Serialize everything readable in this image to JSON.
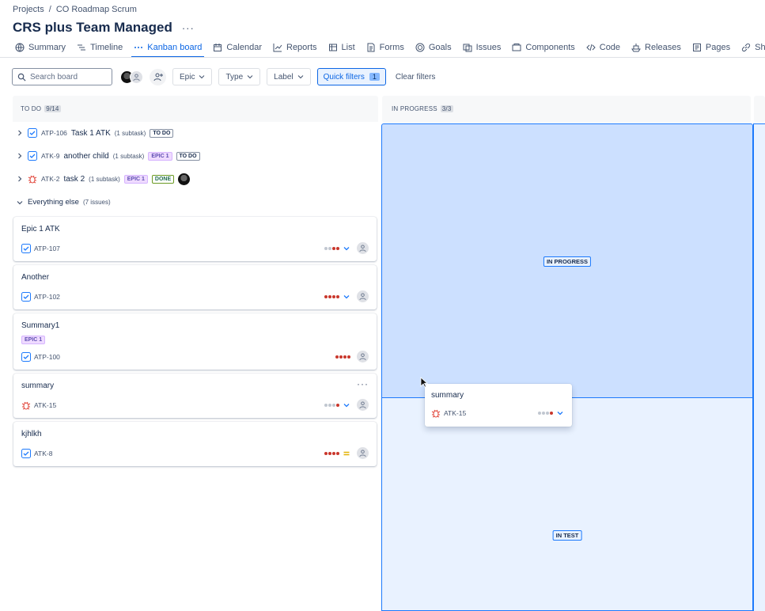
{
  "breadcrumb": {
    "root": "Projects",
    "sep": "/",
    "project": "CO Roadmap Scrum"
  },
  "page": {
    "title": "CRS plus Team Managed",
    "more": "···"
  },
  "tabs": [
    "Summary",
    "Timeline",
    "Kanban board",
    "Calendar",
    "Reports",
    "List",
    "Forms",
    "Goals",
    "Issues",
    "Components",
    "Code",
    "Releases",
    "Pages",
    "Shortcuts"
  ],
  "active_tab": "Kanban board",
  "toolbar": {
    "search_placeholder": "Search board",
    "epic": "Epic",
    "type": "Type",
    "label": "Label",
    "quick_filters": "Quick filters",
    "quick_filters_count": "1",
    "clear": "Clear filters"
  },
  "columns": {
    "todo": {
      "name": "TO DO",
      "count": "9/14"
    },
    "in_progress": {
      "name": "IN PROGRESS",
      "count": "3/3"
    }
  },
  "parents": [
    {
      "key": "ATP-106",
      "summary": "Task 1 ATK",
      "subtask": "(1 subtask)",
      "epic": "",
      "status": "TO DO",
      "type": "task"
    },
    {
      "key": "ATK-9",
      "summary": "another child",
      "subtask": "(1 subtask)",
      "epic": "EPIC 1",
      "status": "TO DO",
      "type": "task"
    },
    {
      "key": "ATK-2",
      "summary": "task 2",
      "subtask": "(1 subtask)",
      "epic": "EPIC 1",
      "status": "DONE",
      "type": "bug"
    }
  ],
  "group": {
    "label": "Everything else",
    "count": "(7 issues)"
  },
  "cards": [
    {
      "summary": "Epic 1 ATK",
      "key": "ATP-107",
      "priority": "low",
      "type": "task"
    },
    {
      "summary": "Another",
      "key": "ATP-102",
      "priority": "highest",
      "type": "task"
    },
    {
      "summary": "Summary1",
      "key": "ATP-100",
      "epic": "EPIC 1",
      "priority": "highest",
      "type": "task"
    },
    {
      "summary": "summary",
      "key": "ATK-15",
      "priority": "low",
      "type": "bug"
    },
    {
      "summary": "kjhlkh",
      "key": "ATK-8",
      "priority": "medium",
      "type": "task"
    }
  ],
  "drop_zones": {
    "in_progress": "IN PROGRESS",
    "in_test": "IN TEST"
  },
  "dragging": {
    "summary": "summary",
    "key": "ATK-15"
  },
  "colors": {
    "accent": "#0c66e4",
    "epic_bg": "#efdbff",
    "bug": "#e2483d",
    "priority_high": "#c9372c"
  }
}
